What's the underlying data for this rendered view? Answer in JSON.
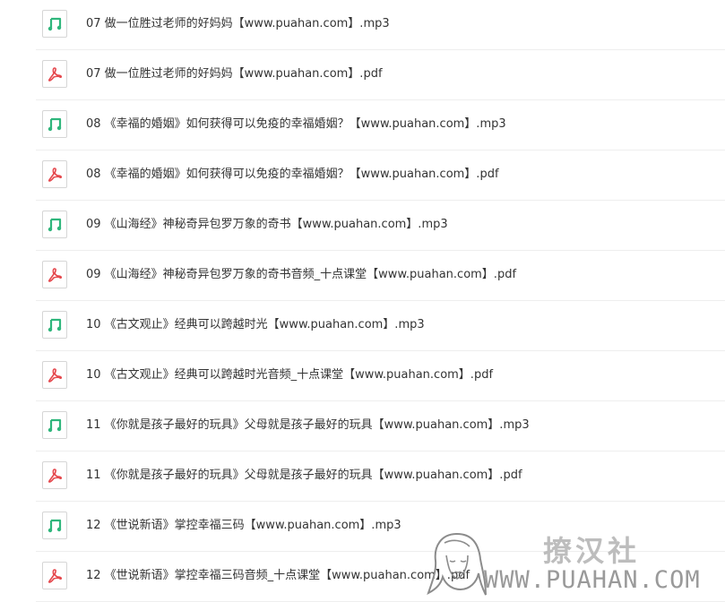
{
  "files": [
    {
      "type": "mp3",
      "name": "07 做一位胜过老师的好妈妈【www.puahan.com】.mp3"
    },
    {
      "type": "pdf",
      "name": "07 做一位胜过老师的好妈妈【www.puahan.com】.pdf"
    },
    {
      "type": "mp3",
      "name": "08 《幸福的婚姻》如何获得可以免疫的幸福婚姻？【www.puahan.com】.mp3"
    },
    {
      "type": "pdf",
      "name": "08 《幸福的婚姻》如何获得可以免疫的幸福婚姻？【www.puahan.com】.pdf"
    },
    {
      "type": "mp3",
      "name": "09 《山海经》神秘奇异包罗万象的奇书【www.puahan.com】.mp3"
    },
    {
      "type": "pdf",
      "name": "09 《山海经》神秘奇异包罗万象的奇书音频_十点课堂【www.puahan.com】.pdf"
    },
    {
      "type": "mp3",
      "name": "10 《古文观止》经典可以跨越时光【www.puahan.com】.mp3"
    },
    {
      "type": "pdf",
      "name": "10 《古文观止》经典可以跨越时光音频_十点课堂【www.puahan.com】.pdf"
    },
    {
      "type": "mp3",
      "name": "11 《你就是孩子最好的玩具》父母就是孩子最好的玩具【www.puahan.com】.mp3"
    },
    {
      "type": "pdf",
      "name": "11 《你就是孩子最好的玩具》父母就是孩子最好的玩具【www.puahan.com】.pdf"
    },
    {
      "type": "mp3",
      "name": "12 《世说新语》掌控幸福三码【www.puahan.com】.mp3"
    },
    {
      "type": "pdf",
      "name": "12 《世说新语》掌控幸福三码音频_十点课堂【www.puahan.com】.pdf"
    }
  ],
  "icons": {
    "mp3": {
      "name": "music-note-icon",
      "color": "#2fb67c"
    },
    "pdf": {
      "name": "pdf-icon",
      "color": "#e5484d"
    }
  },
  "watermark": {
    "brand_cn": "撩汉社",
    "url": "WWW.PUAHAN.COM"
  }
}
